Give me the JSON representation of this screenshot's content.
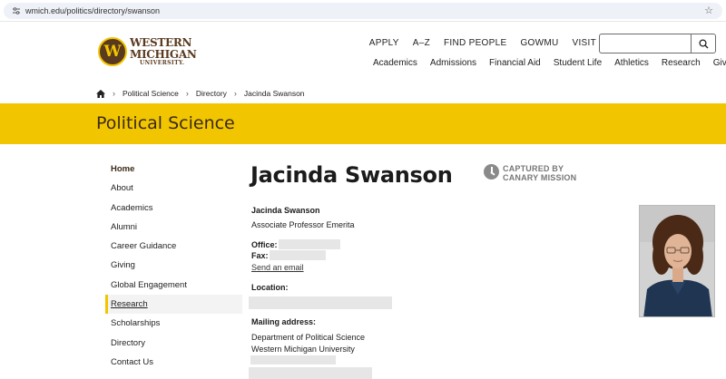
{
  "browser": {
    "url": "wmich.edu/politics/directory/swanson"
  },
  "header": {
    "logo_badge": "W",
    "logo_line1": "WESTERN",
    "logo_line2": "MICHIGAN",
    "logo_line3": "UNIVERSITY.",
    "utility_links": [
      "APPLY",
      "A–Z",
      "FIND PEOPLE",
      "GOWMU",
      "VISIT"
    ],
    "search_placeholder": "",
    "main_nav": [
      "Academics",
      "Admissions",
      "Financial Aid",
      "Student Life",
      "Athletics",
      "Research",
      "Give"
    ]
  },
  "breadcrumb": {
    "items": [
      "Political Science",
      "Directory",
      "Jacinda Swanson"
    ]
  },
  "banner": {
    "title": "Political Science"
  },
  "sidebar": {
    "items": [
      {
        "label": "Home"
      },
      {
        "label": "About"
      },
      {
        "label": "Academics"
      },
      {
        "label": "Alumni"
      },
      {
        "label": "Career Guidance"
      },
      {
        "label": "Giving"
      },
      {
        "label": "Global Engagement"
      },
      {
        "label": "Research"
      },
      {
        "label": "Scholarships"
      },
      {
        "label": "Directory"
      },
      {
        "label": "Contact Us"
      }
    ],
    "active_item": "Research"
  },
  "profile": {
    "page_title": "Jacinda Swanson",
    "badge_line1": "CAPTURED BY",
    "badge_line2": "CANARY MISSION",
    "name": "Jacinda Swanson",
    "role": "Associate Professor Emerita",
    "office_label": "Office:",
    "fax_label": "Fax:",
    "email_link": "Send an email",
    "location_label": "Location:",
    "mailing_label": "Mailing address:",
    "mailing_line1": "Department of Political Science",
    "mailing_line2": "Western Michigan University"
  },
  "colors": {
    "brand_gold": "#f1c500",
    "brand_brown": "#5a3a1f"
  }
}
